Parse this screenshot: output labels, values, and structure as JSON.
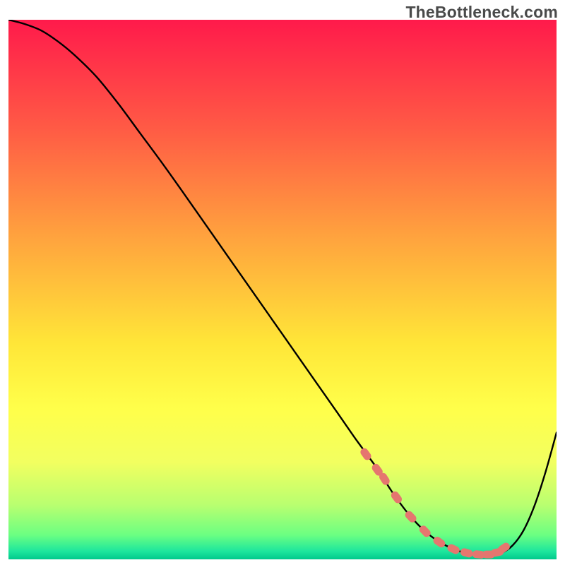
{
  "watermark": "TheBottleneck.com",
  "chart_data": {
    "type": "line",
    "title": "",
    "xlabel": "",
    "ylabel": "",
    "xlim": [
      0,
      100
    ],
    "ylim": [
      0,
      100
    ],
    "grid": false,
    "gradient_stops": [
      {
        "offset": 0.0,
        "color": "#ff1a4b"
      },
      {
        "offset": 0.2,
        "color": "#ff5a45"
      },
      {
        "offset": 0.4,
        "color": "#ffa23e"
      },
      {
        "offset": 0.6,
        "color": "#ffe638"
      },
      {
        "offset": 0.72,
        "color": "#ffff4a"
      },
      {
        "offset": 0.82,
        "color": "#f2ff60"
      },
      {
        "offset": 0.9,
        "color": "#b8ff70"
      },
      {
        "offset": 0.955,
        "color": "#6bff82"
      },
      {
        "offset": 0.985,
        "color": "#1de69d"
      },
      {
        "offset": 1.0,
        "color": "#00c98c"
      }
    ],
    "curve": {
      "x": [
        0,
        3,
        6,
        9,
        12,
        16,
        20,
        24,
        28,
        32,
        36,
        40,
        44,
        48,
        52,
        56,
        60,
        63,
        65,
        67.5,
        70,
        73,
        76,
        79,
        82,
        84,
        86,
        88,
        90,
        92,
        94,
        96,
        98,
        100
      ],
      "y": [
        100,
        99.2,
        98.0,
        96.0,
        93.5,
        89.5,
        84.5,
        79.0,
        73.5,
        67.8,
        62.0,
        56.2,
        50.4,
        44.6,
        38.8,
        33.0,
        27.2,
        22.8,
        20.0,
        16.5,
        12.5,
        8.4,
        5.2,
        3.0,
        1.6,
        1.0,
        0.8,
        0.8,
        1.2,
        2.6,
        5.4,
        10.0,
        16.2,
        23.5
      ]
    },
    "markers": {
      "type": "rounded-bead",
      "color": "#e5766f",
      "x": [
        65.2,
        67.3,
        68.6,
        70.8,
        73.4,
        76.0,
        78.6,
        81.2,
        83.6,
        85.8,
        87.6,
        89.2,
        90.4
      ],
      "y": [
        19.5,
        16.6,
        14.9,
        11.5,
        7.9,
        5.2,
        3.2,
        1.9,
        1.2,
        0.9,
        0.9,
        1.3,
        2.1
      ]
    }
  }
}
